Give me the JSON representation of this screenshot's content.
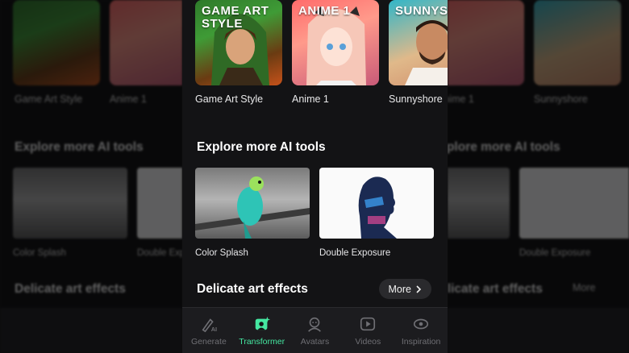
{
  "styles": [
    {
      "label": "Game Art Style",
      "tag": "GAME ART STYLE"
    },
    {
      "label": "Anime 1",
      "tag": "ANIME 1"
    },
    {
      "label": "Sunnyshore",
      "tag": "SUNNYSHORE"
    }
  ],
  "sections": {
    "explore_title": "Explore more AI tools",
    "effects_title": "Delicate art effects",
    "more_label": "More"
  },
  "tools": [
    {
      "label": "Color Splash"
    },
    {
      "label": "Double Exposure"
    }
  ],
  "tabs": [
    {
      "label": "Generate",
      "icon": "brush-ai-icon",
      "active": false
    },
    {
      "label": "Transformer",
      "icon": "transform-image-icon",
      "active": true
    },
    {
      "label": "Avatars",
      "icon": "avatar-icon",
      "active": false
    },
    {
      "label": "Videos",
      "icon": "play-icon",
      "active": false
    },
    {
      "label": "Inspiration",
      "icon": "inspiration-icon",
      "active": false
    }
  ],
  "colors": {
    "accent": "#45e7a1",
    "background": "#131315"
  }
}
